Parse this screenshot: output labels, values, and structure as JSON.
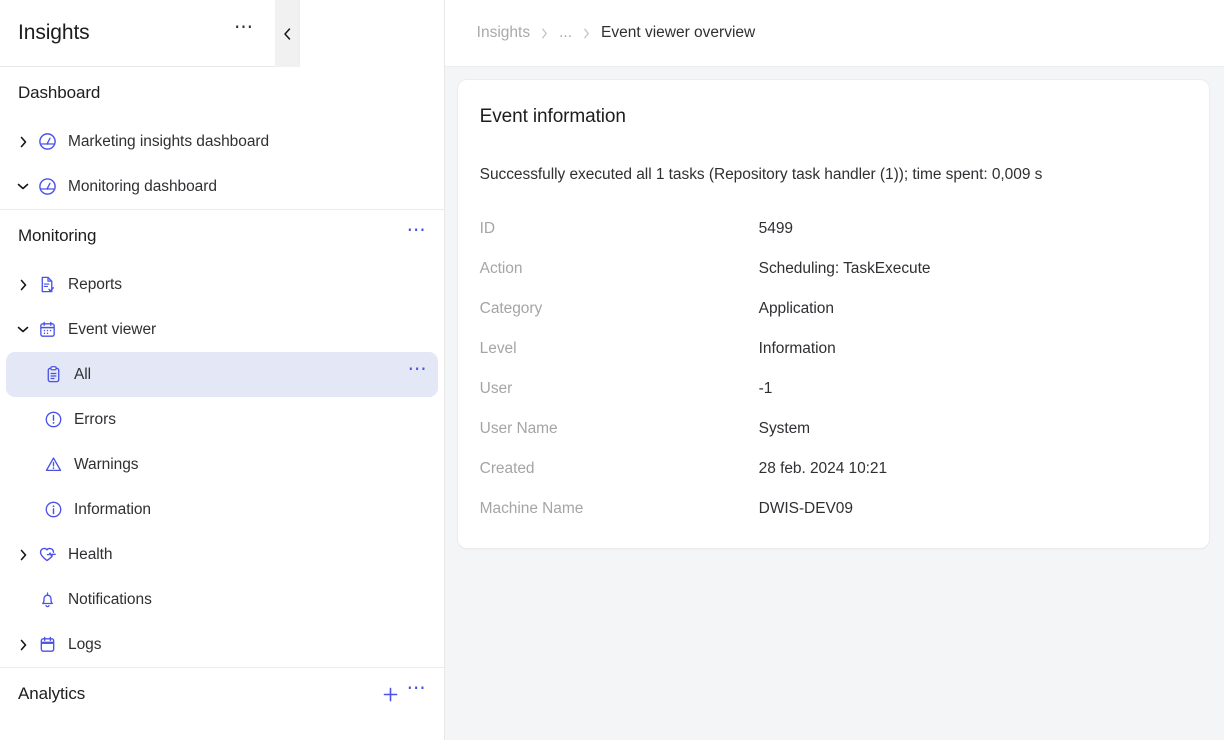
{
  "sidebar": {
    "title": "Insights",
    "header_menu_icon": "ellipsis-icon",
    "collapse_icon": "chevron-left-icon",
    "sections": [
      {
        "id": "dashboard",
        "title": "Dashboard",
        "items": [
          {
            "label": "Marketing insights dashboard",
            "icon": "gauge-icon",
            "chevron": "chevron-right-icon",
            "indent": false,
            "selected": false,
            "dots": false
          },
          {
            "label": "Monitoring dashboard",
            "icon": "gauge-icon",
            "chevron": "chevron-down-icon",
            "indent": false,
            "selected": false,
            "dots": false
          }
        ]
      },
      {
        "id": "monitoring",
        "title": "Monitoring",
        "menu_icon": "ellipsis-icon",
        "items": [
          {
            "label": "Reports",
            "icon": "document-check-icon",
            "chevron": "chevron-right-icon",
            "indent": false,
            "selected": false,
            "dots": false
          },
          {
            "label": "Event viewer",
            "icon": "calendar-icon",
            "chevron": "chevron-down-icon",
            "indent": false,
            "selected": false,
            "dots": false
          },
          {
            "label": "All",
            "icon": "clipboard-icon",
            "chevron": "",
            "indent": true,
            "selected": true,
            "dots": true
          },
          {
            "label": "Errors",
            "icon": "error-circle-icon",
            "chevron": "",
            "indent": true,
            "selected": false,
            "dots": false
          },
          {
            "label": "Warnings",
            "icon": "warning-triangle-icon",
            "chevron": "",
            "indent": true,
            "selected": false,
            "dots": false
          },
          {
            "label": "Information",
            "icon": "info-circle-icon",
            "chevron": "",
            "indent": true,
            "selected": false,
            "dots": false
          },
          {
            "label": "Health",
            "icon": "heart-pulse-icon",
            "chevron": "chevron-right-icon",
            "indent": false,
            "selected": false,
            "dots": false
          },
          {
            "label": "Notifications",
            "icon": "bell-icon",
            "chevron": "",
            "indent": false,
            "selected": false,
            "dots": false
          },
          {
            "label": "Logs",
            "icon": "calendar-icon",
            "chevron": "chevron-right-icon",
            "indent": false,
            "selected": false,
            "dots": false
          }
        ]
      },
      {
        "id": "analytics",
        "title": "Analytics",
        "add_icon": "plus-icon",
        "menu_icon": "ellipsis-icon",
        "items": []
      }
    ]
  },
  "topbar": {
    "breadcrumb": [
      {
        "label": "Insights",
        "current": false
      },
      {
        "label": "...",
        "current": false
      },
      {
        "label": "Event viewer overview",
        "current": true
      }
    ],
    "separator_icon": "chevron-right-icon"
  },
  "card": {
    "title": "Event information",
    "description": "Successfully executed all 1 tasks (Repository task handler (1)); time spent: 0,009 s",
    "details": [
      {
        "label": "ID",
        "value": "5499"
      },
      {
        "label": "Action",
        "value": "Scheduling: TaskExecute"
      },
      {
        "label": "Category",
        "value": "Application"
      },
      {
        "label": "Level",
        "value": "Information"
      },
      {
        "label": "User",
        "value": "-1"
      },
      {
        "label": "User Name",
        "value": "System"
      },
      {
        "label": "Created",
        "value": "28 feb. 2024 10:21"
      },
      {
        "label": "Machine Name",
        "value": "DWIS-DEV09"
      }
    ]
  },
  "colors": {
    "accent": "#4a52e8",
    "selected_bg": "#e4e8f6",
    "page_bg": "#f4f5f6",
    "card_bg": "#ffffff",
    "text": "#2f3033",
    "muted": "#a4a5a7",
    "border": "#ececec"
  }
}
